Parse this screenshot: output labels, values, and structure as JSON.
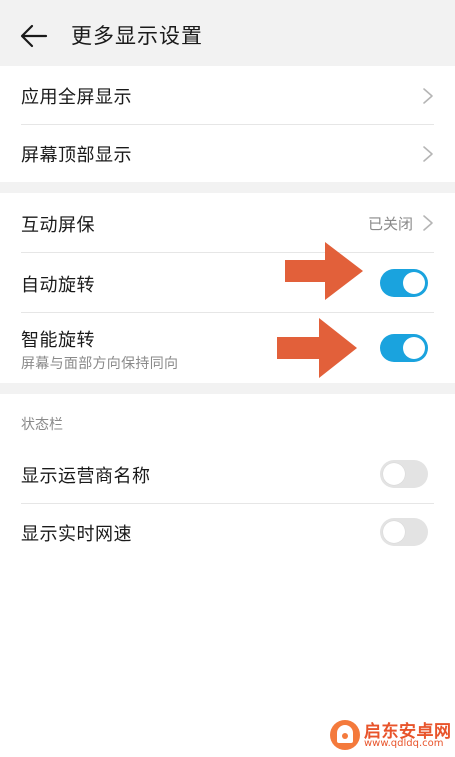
{
  "header": {
    "title": "更多显示设置"
  },
  "group1": {
    "items": [
      {
        "label": "应用全屏显示"
      },
      {
        "label": "屏幕顶部显示"
      }
    ]
  },
  "group2": {
    "screensaver": {
      "label": "互动屏保",
      "value": "已关闭"
    },
    "auto_rotate": {
      "label": "自动旋转",
      "on": true
    },
    "smart_rotate": {
      "label": "智能旋转",
      "sub": "屏幕与面部方向保持同向",
      "on": true
    }
  },
  "status_bar": {
    "section_title": "状态栏",
    "carrier_name": {
      "label": "显示运营商名称",
      "on": false
    },
    "network_speed": {
      "label": "显示实时网速",
      "on": false
    }
  },
  "watermark": {
    "title": "启东安卓网",
    "url": "www.qdldq.com"
  },
  "colors": {
    "toggle_on": "#1aa3de",
    "toggle_off": "#e3e3e3",
    "arrow": "#e2603a",
    "watermark": "#e8542b"
  }
}
